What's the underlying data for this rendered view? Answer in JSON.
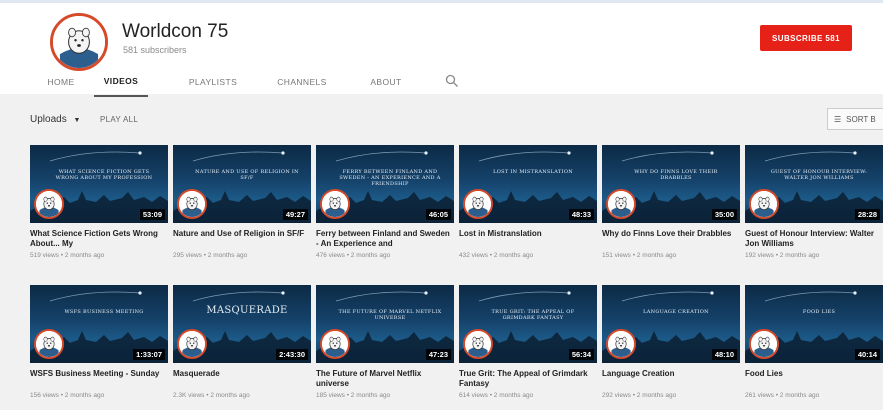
{
  "channel": {
    "name": "Worldcon 75",
    "subscribers": "581 subscribers",
    "subscribe_label": "SUBSCRIBE 581",
    "accent": "#e62117"
  },
  "tabs": [
    {
      "label": "HOME",
      "active": false
    },
    {
      "label": "VIDEOS",
      "active": true
    },
    {
      "label": "PLAYLISTS",
      "active": false
    },
    {
      "label": "CHANNELS",
      "active": false
    },
    {
      "label": "ABOUT",
      "active": false
    }
  ],
  "search_tab_icon": "search-icon",
  "toolbar": {
    "uploads_label": "Uploads",
    "play_all_label": "PLAY ALL",
    "sort_label": "SORT B"
  },
  "videos": [
    {
      "thumb_text": "WHAT SCIENCE FICTION GETS WRONG ABOUT MY PROFESSION",
      "duration": "53:09",
      "title": "What Science Fiction Gets Wrong About... My",
      "meta": "519 views • 2 months ago"
    },
    {
      "thumb_text": "NATURE AND USE OF RELIGION IN SF/F",
      "duration": "49:27",
      "title": "Nature and Use of Religion in SF/F",
      "meta": "295 views • 2 months ago"
    },
    {
      "thumb_text": "FERRY BETWEEN FINLAND AND SWEDEN - AN EXPERIENCE AND A FRIENDSHIP",
      "duration": "46:05",
      "title": "Ferry between Finland and Sweden - An Experience and",
      "meta": "476 views • 2 months ago"
    },
    {
      "thumb_text": "LOST IN MISTRANSLATION",
      "duration": "48:33",
      "title": "Lost in Mistranslation",
      "meta": "432 views • 2 months ago"
    },
    {
      "thumb_text": "WHY DO FINNS LOVE THEIR DRABBLES",
      "duration": "35:00",
      "title": "Why do Finns Love their Drabbles",
      "meta": "151 views • 2 months ago"
    },
    {
      "thumb_text": "GUEST OF HONOUR INTERVIEW: WALTER JON WILLIAMS",
      "duration": "28:28",
      "title": "Guest of Honour Interview: Walter Jon Williams",
      "meta": "192 views • 2 months ago"
    },
    {
      "thumb_text": "WSFS BUSINESS MEETING",
      "duration": "1:33:07",
      "title": "WSFS Business Meeting - Sunday",
      "meta": "156 views • 2 months ago"
    },
    {
      "thumb_text": "MASQUERADE",
      "duration": "2:43:30",
      "title": "Masquerade",
      "meta": "2.3K views • 2 months ago",
      "big": true
    },
    {
      "thumb_text": "THE FUTURE OF MARVEL NETFLIX UNIVERSE",
      "duration": "47:23",
      "title": "The Future of Marvel Netflix universe",
      "meta": "185 views • 2 months ago"
    },
    {
      "thumb_text": "TRUE GRIT: THE APPEAL OF GRIMDARK FANTASY",
      "duration": "56:34",
      "title": "True Grit: The Appeal of Grimdark Fantasy",
      "meta": "614 views • 2 months ago"
    },
    {
      "thumb_text": "LANGUAGE CREATION",
      "duration": "48:10",
      "title": "Language Creation",
      "meta": "292 views • 2 months ago"
    },
    {
      "thumb_text": "FOOD LIES",
      "duration": "40:14",
      "title": "Food Lies",
      "meta": "261 views • 2 months ago"
    }
  ]
}
